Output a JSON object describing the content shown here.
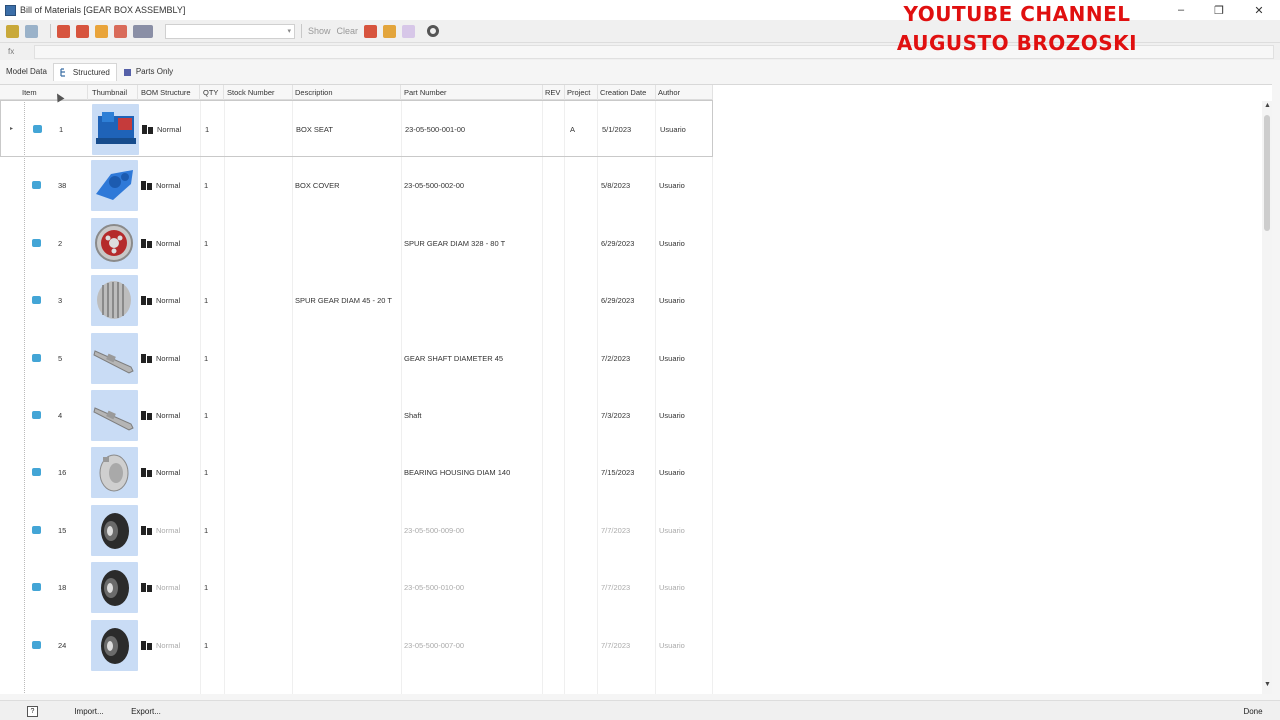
{
  "window": {
    "title": "Bill of Materials [GEAR BOX ASSEMBLY]",
    "minimize": "–",
    "restore": "❐",
    "close": "✕"
  },
  "watermark": {
    "line1": "YOUTUBE CHANNEL",
    "line2": "AUGUSTO BROZOSKI",
    "color": "#e01010"
  },
  "toolbar": {
    "show_label": "Show",
    "clear_label": "Clear",
    "combo_value": "",
    "fx_label": "fx"
  },
  "tabs": [
    {
      "label": "Model Data",
      "active": false
    },
    {
      "label": "Structured",
      "active": true
    },
    {
      "label": "Parts Only",
      "active": false
    }
  ],
  "columns": [
    "Item",
    "Thumbnail",
    "BOM Structure",
    "QTY",
    "Stock Number",
    "Description",
    "Part Number",
    "REV",
    "Project",
    "Creation Date",
    "Author"
  ],
  "rows": [
    {
      "item": "1",
      "bom": "Normal",
      "qty": "1",
      "stock": "",
      "description": "BOX SEAT",
      "part": "23-05-500-001-00",
      "rev": "",
      "project": "A",
      "date": "5/1/2023",
      "author": "Usuario",
      "thumb": "housing",
      "gray": false
    },
    {
      "item": "38",
      "bom": "Normal",
      "qty": "1",
      "stock": "",
      "description": "BOX COVER",
      "part": "23-05-500-002-00",
      "rev": "",
      "project": "",
      "date": "5/8/2023",
      "author": "Usuario",
      "thumb": "cover",
      "gray": false
    },
    {
      "item": "2",
      "bom": "Normal",
      "qty": "1",
      "stock": "",
      "description": "",
      "part": "SPUR GEAR DIAM 328 - 80 T",
      "rev": "",
      "project": "",
      "date": "6/29/2023",
      "author": "Usuario",
      "thumb": "gear-red",
      "gray": false
    },
    {
      "item": "3",
      "bom": "Normal",
      "qty": "1",
      "stock": "",
      "description": "SPUR GEAR DIAM 45 - 20 T",
      "part": "",
      "rev": "",
      "project": "",
      "date": "6/29/2023",
      "author": "Usuario",
      "thumb": "pinion",
      "gray": false
    },
    {
      "item": "5",
      "bom": "Normal",
      "qty": "1",
      "stock": "",
      "description": "",
      "part": "GEAR SHAFT DIAMETER 45",
      "rev": "",
      "project": "",
      "date": "7/2/2023",
      "author": "Usuario",
      "thumb": "shaft",
      "gray": false
    },
    {
      "item": "4",
      "bom": "Normal",
      "qty": "1",
      "stock": "",
      "description": "",
      "part": "Shaft",
      "rev": "",
      "project": "",
      "date": "7/3/2023",
      "author": "Usuario",
      "thumb": "shaft",
      "gray": false
    },
    {
      "item": "16",
      "bom": "Normal",
      "qty": "1",
      "stock": "",
      "description": "",
      "part": "BEARING HOUSING DIAM 140",
      "rev": "",
      "project": "",
      "date": "7/15/2023",
      "author": "Usuario",
      "thumb": "bearing-housing",
      "gray": false
    },
    {
      "item": "15",
      "bom": "Normal",
      "qty": "1",
      "stock": "",
      "description": "",
      "part": "23-05-500-009-00",
      "rev": "",
      "project": "",
      "date": "7/7/2023",
      "author": "Usuario",
      "thumb": "bearing",
      "gray": true
    },
    {
      "item": "18",
      "bom": "Normal",
      "qty": "1",
      "stock": "",
      "description": "",
      "part": "23-05-500-010-00",
      "rev": "",
      "project": "",
      "date": "7/7/2023",
      "author": "Usuario",
      "thumb": "bearing",
      "gray": true
    },
    {
      "item": "24",
      "bom": "Normal",
      "qty": "1",
      "stock": "",
      "description": "",
      "part": "23-05-500-007-00",
      "rev": "",
      "project": "",
      "date": "7/7/2023",
      "author": "Usuario",
      "thumb": "bearing",
      "gray": true
    }
  ],
  "bottom": {
    "help": "?",
    "import": "Import...",
    "export": "Export...",
    "done": "Done"
  }
}
